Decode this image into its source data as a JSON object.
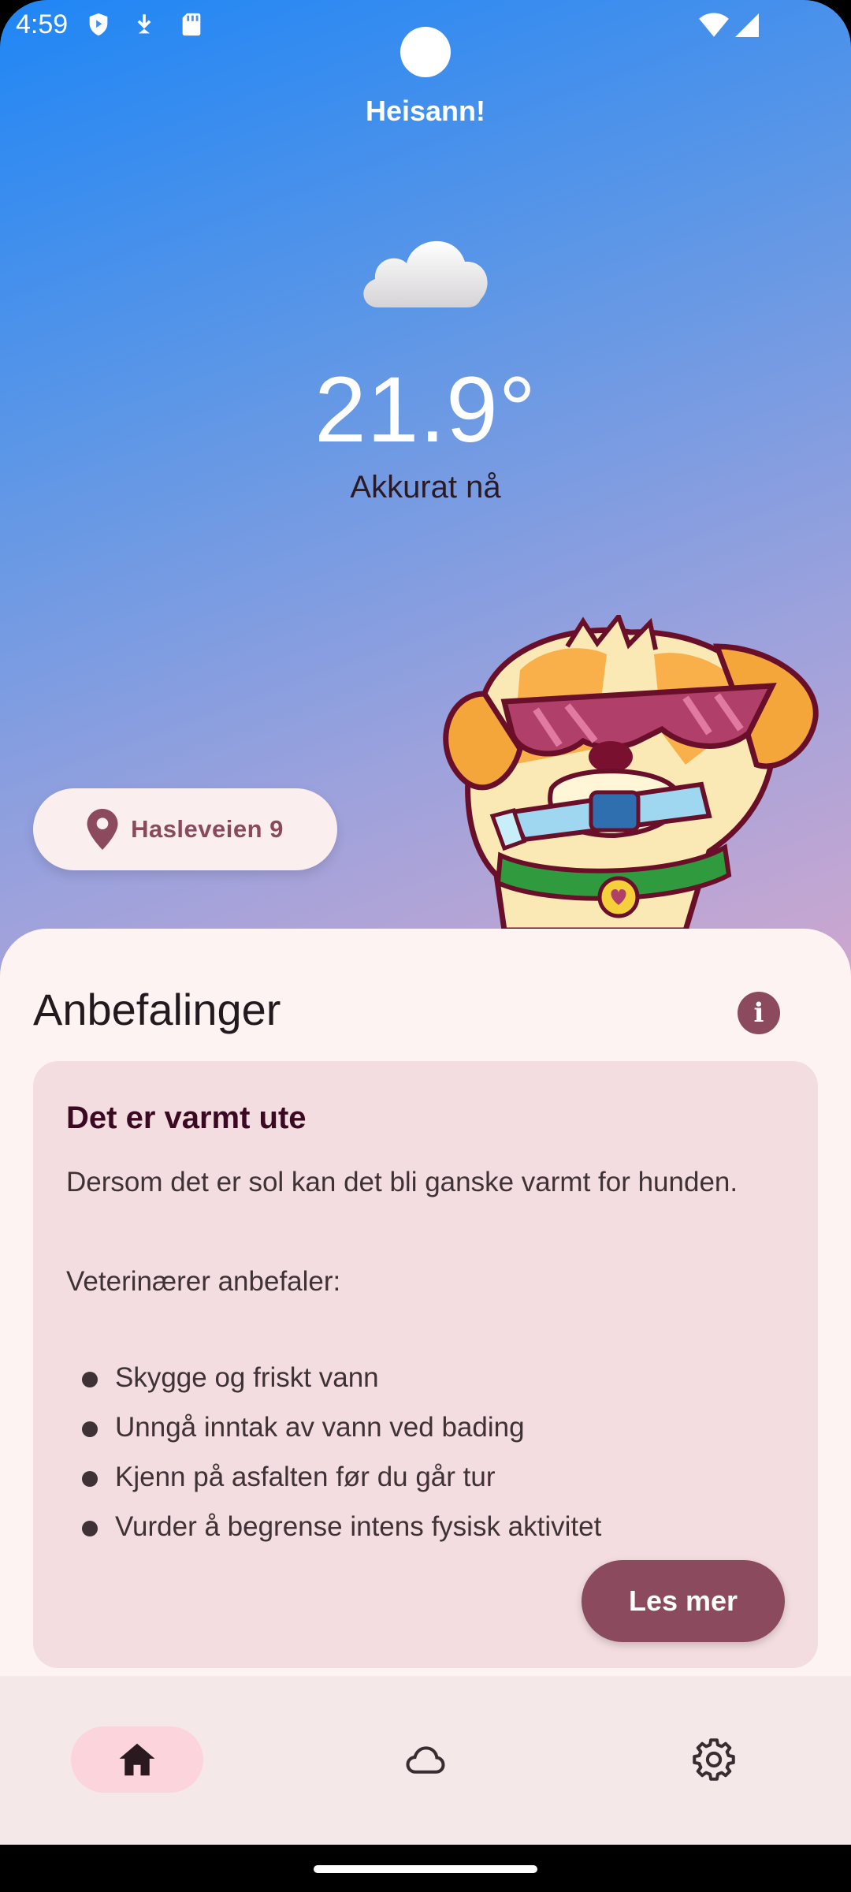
{
  "status_bar": {
    "time": "4:59",
    "left_icons": [
      "play-protect-icon",
      "download-icon",
      "sd-card-icon"
    ],
    "right_icons": [
      "wifi-icon",
      "cellular-signal-icon"
    ]
  },
  "header": {
    "greeting": "Heisann!"
  },
  "weather": {
    "icon": "cloud-icon",
    "temperature": "21.9°",
    "time_label": "Akkurat nå"
  },
  "location": {
    "icon": "location-pin-icon",
    "label": "Hasleveien 9"
  },
  "recommendations": {
    "title": "Anbefalinger",
    "info_icon": "info-icon",
    "card": {
      "title": "Det er varmt ute",
      "text1": "Dersom det er sol kan det bli ganske varmt for hunden.",
      "text2": "Veterinærer anbefaler:",
      "bullets": [
        "Skygge og friskt vann",
        "Unngå inntak av vann ved bading",
        "Kjenn på asfalten før du går tur",
        "Vurder å begrense intens fysisk aktivitet"
      ],
      "button_label": "Les mer"
    }
  },
  "bottom_nav": {
    "items": [
      {
        "icon": "home-icon",
        "active": true
      },
      {
        "icon": "cloud-outline-icon",
        "active": false
      },
      {
        "icon": "settings-gear-icon",
        "active": false
      }
    ]
  },
  "colors": {
    "accent": "#8c4a5e",
    "sheet_background": "#fdf3f2",
    "card_background": "#f3dde0",
    "nav_active_pill": "#fcd4dc",
    "gradient_top": "#1f86f5",
    "gradient_bottom": "#fbb3c4"
  }
}
